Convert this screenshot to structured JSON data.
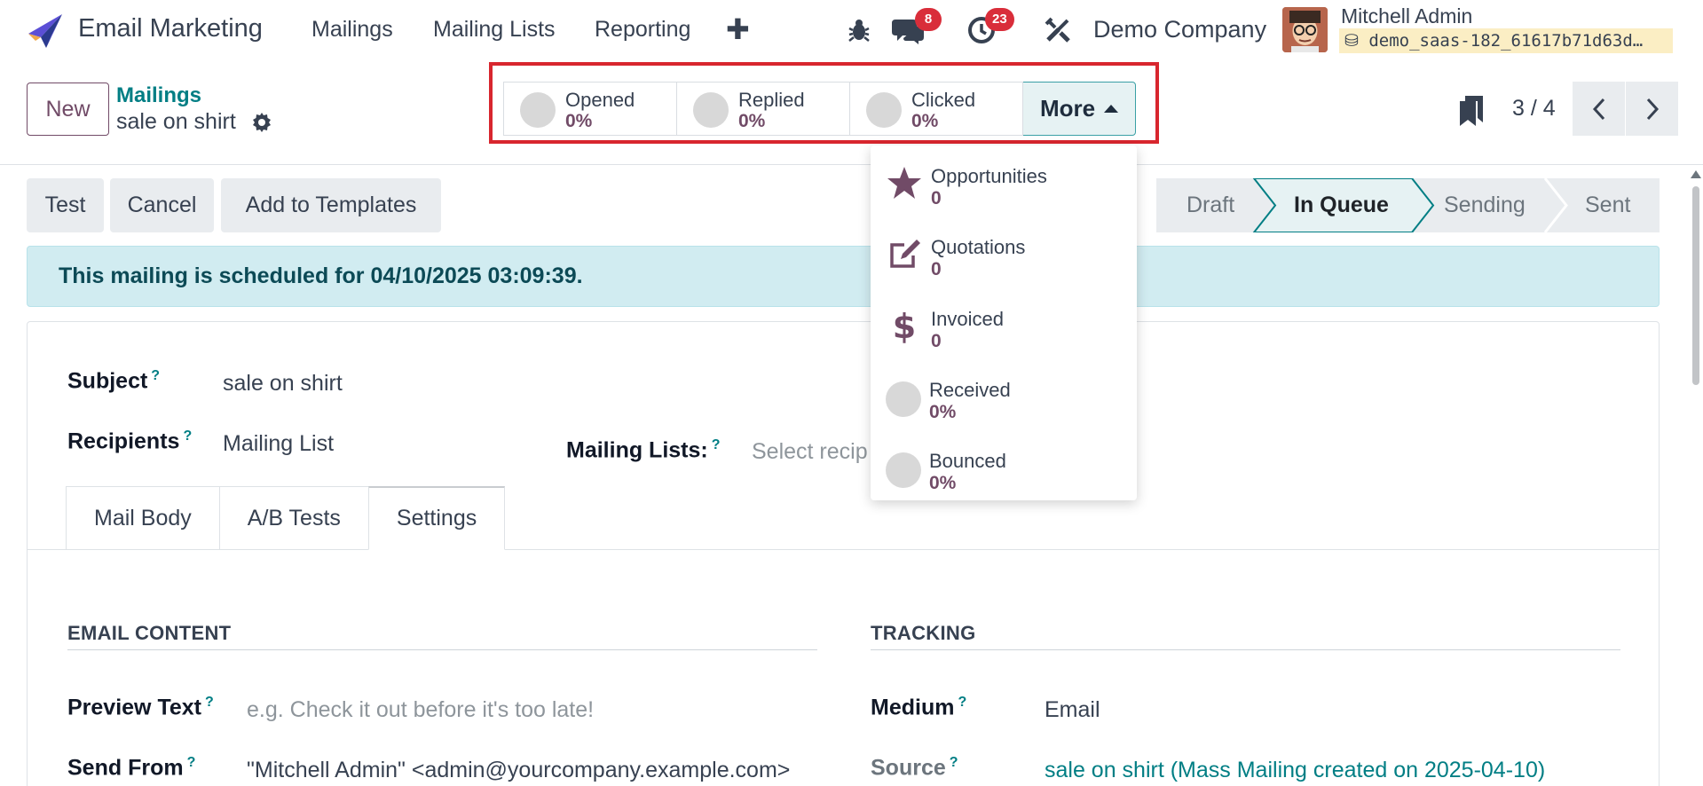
{
  "navbar": {
    "app_name": "Email Marketing",
    "menus": [
      "Mailings",
      "Mailing Lists",
      "Reporting"
    ],
    "messages_badge": "8",
    "activities_badge": "23",
    "company": "Demo Company",
    "user_name": "Mitchell Admin",
    "database": "demo_saas-182_61617b71d63d…"
  },
  "control": {
    "new_label": "New",
    "breadcrumb_parent": "Mailings",
    "record_name": "sale on shirt",
    "pager": "3 / 4",
    "more_label": "More"
  },
  "stats": [
    {
      "label": "Opened",
      "value": "0%"
    },
    {
      "label": "Replied",
      "value": "0%"
    },
    {
      "label": "Clicked",
      "value": "0%"
    }
  ],
  "more_menu": [
    {
      "label": "Opportunities",
      "value": "0",
      "icon": "star-icon"
    },
    {
      "label": "Quotations",
      "value": "0",
      "icon": "edit-icon"
    },
    {
      "label": "Invoiced",
      "value": "0",
      "icon": "dollar-icon"
    },
    {
      "label": "Received",
      "value": "0%",
      "icon": "circle"
    },
    {
      "label": "Bounced",
      "value": "0%",
      "icon": "circle"
    }
  ],
  "actions": {
    "test": "Test",
    "cancel": "Cancel",
    "add_templates": "Add to Templates"
  },
  "stages": [
    "Draft",
    "In Queue",
    "Sending",
    "Sent"
  ],
  "current_stage": "In Queue",
  "alert": "This mailing is scheduled for 04/10/2025 03:09:39.",
  "form": {
    "subject_label": "Subject",
    "subject_value": "sale on shirt",
    "recipients_label": "Recipients",
    "recipients_value": "Mailing List",
    "mailing_lists_label": "Mailing Lists:",
    "mailing_lists_placeholder": "Select recip"
  },
  "tabs": [
    "Mail Body",
    "A/B Tests",
    "Settings"
  ],
  "active_tab": "Settings",
  "settings": {
    "email_content_title": "EMAIL CONTENT",
    "tracking_title": "TRACKING",
    "preview_text_label": "Preview Text",
    "preview_text_placeholder": "e.g. Check it out before it's too late!",
    "send_from_label": "Send From",
    "send_from_value": "\"Mitchell Admin\" <admin@yourcompany.example.com>",
    "medium_label": "Medium",
    "medium_value": "Email",
    "source_label": "Source",
    "source_value": "sale on shirt (Mass Mailing created on 2025-04-10)"
  },
  "colors": {
    "primary": "#714b67",
    "link": "#017e84",
    "highlight_frame": "#d8262e",
    "badge": "#d92d3a"
  }
}
